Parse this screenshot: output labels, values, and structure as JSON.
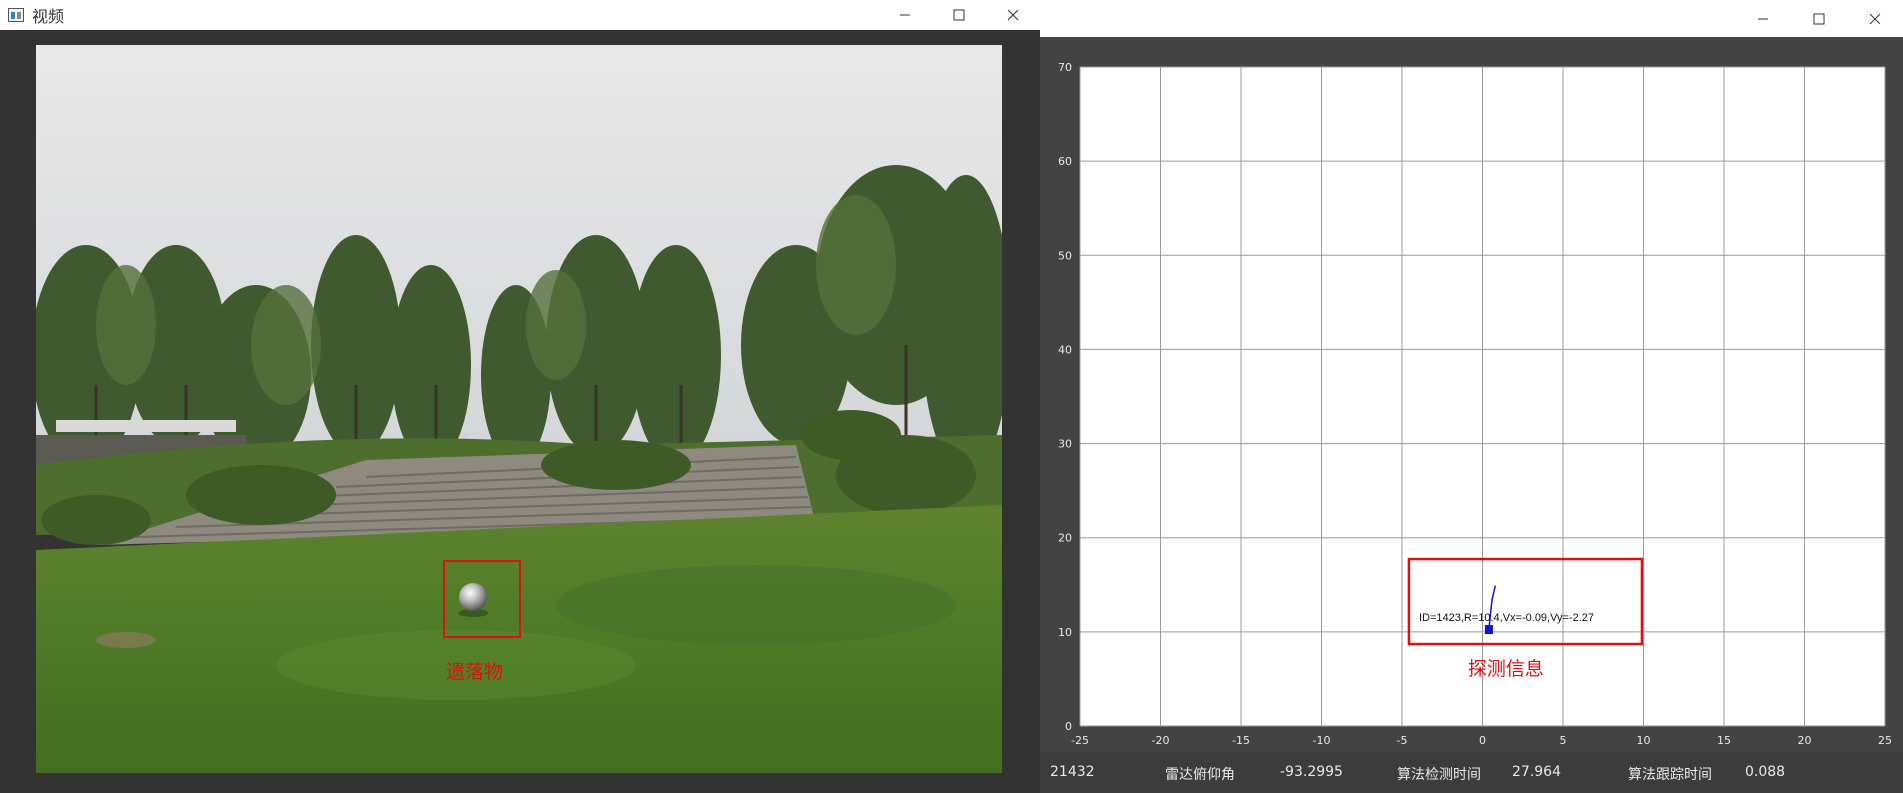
{
  "video_window": {
    "title": "视频",
    "detect_label": "遗落物"
  },
  "radar_window": {
    "title": "",
    "target_label": "ID=1423,R=10.4,Vx=-0.09,Vy=-2.27",
    "info_label": "探测信息"
  },
  "status_bar": {
    "frame_count": "21432",
    "pitch_label": "雷达俯仰角",
    "pitch_value": "-93.2995",
    "detect_time_label": "算法检测时间",
    "detect_time_value": "27.964",
    "track_time_label": "算法跟踪时间",
    "track_time_value": "0.088"
  },
  "chart_data": {
    "type": "scatter",
    "x_range": [
      -25,
      25
    ],
    "y_range": [
      0,
      70
    ],
    "x_ticks": [
      "-25",
      "-20",
      "-15",
      "-10",
      "-5",
      "0",
      "5",
      "10",
      "15",
      "20",
      "25"
    ],
    "y_ticks": [
      "0",
      "10",
      "20",
      "30",
      "40",
      "50",
      "60",
      "70"
    ],
    "grid": true,
    "points": [
      {
        "x": 0.4,
        "y": 10.3,
        "label": "ID=1423,R=10.4,Vx=-0.09,Vy=-2.27"
      }
    ],
    "track": [
      [
        0.4,
        10.3
      ],
      [
        0.5,
        12.0
      ],
      [
        0.6,
        13.5
      ],
      [
        0.8,
        14.9
      ]
    ],
    "colors": {
      "point": "#1212d8",
      "grid": "#9a9a9a",
      "highlight": "#e01010"
    }
  }
}
